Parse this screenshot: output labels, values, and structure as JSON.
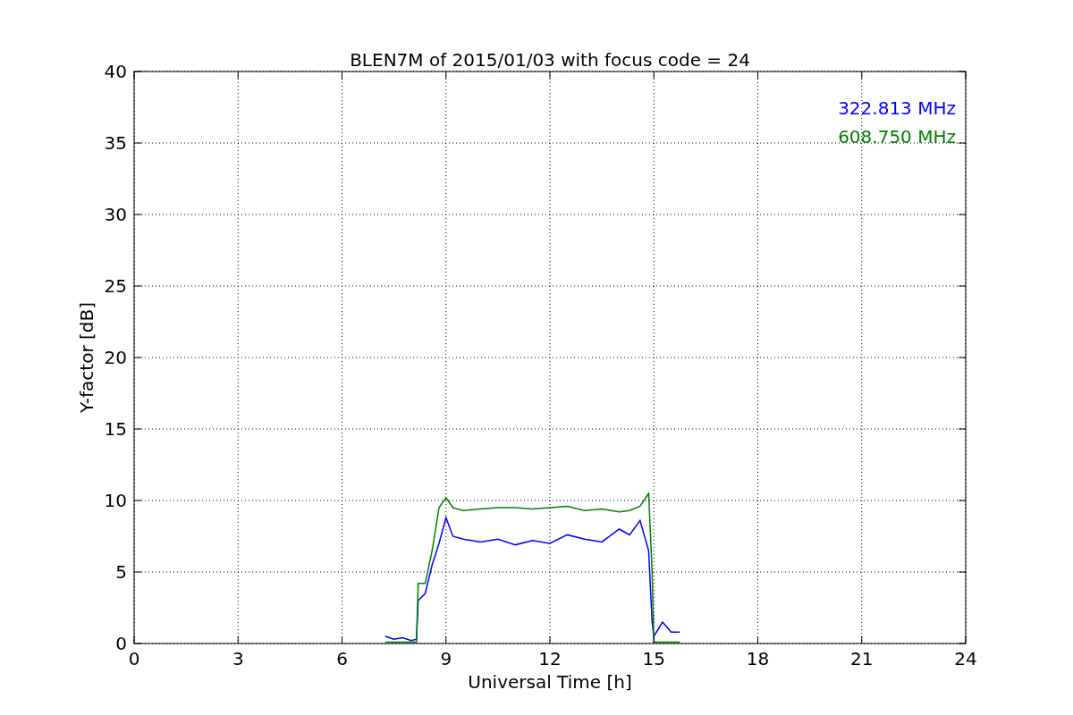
{
  "figure": {
    "chart_data": {
      "type": "line",
      "title": "BLEN7M of 2015/01/03 with focus code = 24",
      "xlabel": "Universal Time [h]",
      "ylabel": "Y-factor [dB]",
      "x": [
        7.25,
        7.5,
        7.75,
        8.0,
        8.15,
        8.2,
        8.4,
        8.6,
        8.8,
        9.0,
        9.2,
        9.5,
        10,
        10.5,
        11,
        11.5,
        12,
        12.5,
        13,
        13.5,
        14,
        14.3,
        14.6,
        14.85,
        14.95,
        15.0,
        15.25,
        15.5,
        15.75
      ],
      "series": [
        {
          "name": "322.813 MHz",
          "color": "#0000ff",
          "values": [
            0.5,
            0.3,
            0.4,
            0.2,
            0.3,
            3.0,
            3.5,
            5.5,
            7.0,
            8.8,
            7.5,
            7.3,
            7.1,
            7.3,
            6.9,
            7.2,
            7.0,
            7.6,
            7.3,
            7.1,
            8.0,
            7.6,
            8.6,
            6.5,
            1.5,
            0.5,
            1.5,
            0.8,
            0.8
          ]
        },
        {
          "name": "608.750 MHz",
          "color": "#008000",
          "values": [
            0.1,
            0.1,
            0.1,
            0.1,
            0.1,
            4.2,
            4.2,
            6.5,
            9.5,
            10.2,
            9.5,
            9.3,
            9.4,
            9.5,
            9.5,
            9.4,
            9.5,
            9.6,
            9.3,
            9.4,
            9.2,
            9.3,
            9.6,
            10.5,
            5.0,
            0.1,
            0.1,
            0.1,
            0.1
          ]
        }
      ],
      "grid": true,
      "xlim": [
        0,
        24
      ],
      "ylim": [
        0,
        40
      ],
      "xticks": [
        0,
        3,
        6,
        9,
        12,
        15,
        18,
        21,
        24
      ],
      "yticks": [
        0,
        5,
        10,
        15,
        20,
        25,
        30,
        35,
        40
      ]
    }
  }
}
